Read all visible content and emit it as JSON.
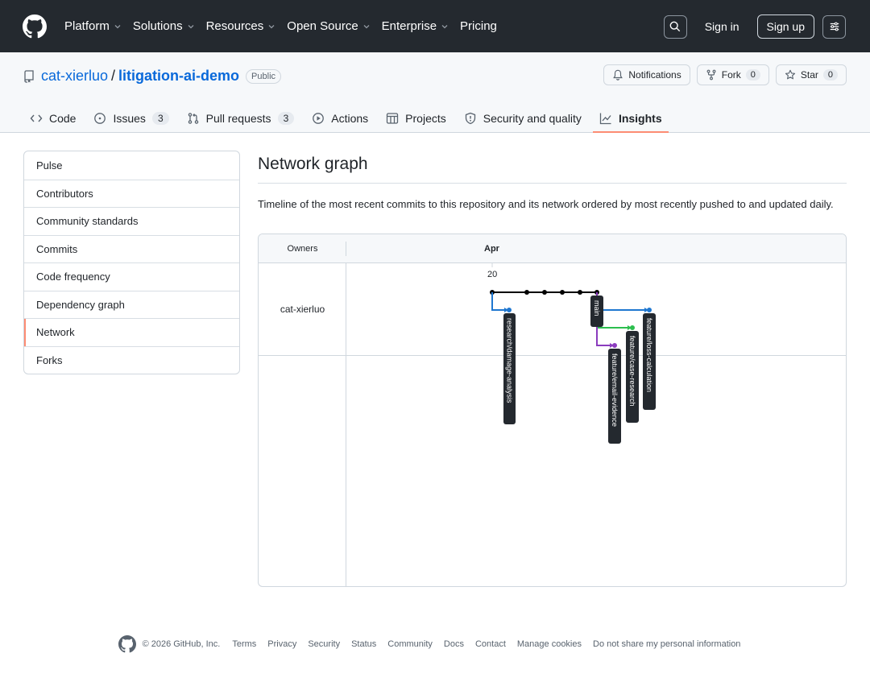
{
  "nav": {
    "items": [
      "Platform",
      "Solutions",
      "Resources",
      "Open Source",
      "Enterprise",
      "Pricing"
    ],
    "signin": "Sign in",
    "signup": "Sign up"
  },
  "repo": {
    "owner": "cat-xierluo",
    "slash": "/",
    "name": "litigation-ai-demo",
    "visibility": "Public",
    "notifications_label": "Notifications",
    "fork_label": "Fork",
    "fork_count": "0",
    "star_label": "Star",
    "star_count": "0"
  },
  "tabs": [
    {
      "label": "Code",
      "icon": "code-icon"
    },
    {
      "label": "Issues",
      "count": "3",
      "icon": "issue-icon"
    },
    {
      "label": "Pull requests",
      "count": "3",
      "icon": "pull-request-icon"
    },
    {
      "label": "Actions",
      "icon": "play-icon"
    },
    {
      "label": "Projects",
      "icon": "table-icon"
    },
    {
      "label": "Security and quality",
      "icon": "shield-icon"
    },
    {
      "label": "Insights",
      "icon": "graph-icon",
      "active": true
    }
  ],
  "sidebar": {
    "items": [
      "Pulse",
      "Contributors",
      "Community standards",
      "Commits",
      "Code frequency",
      "Dependency graph",
      "Network",
      "Forks"
    ],
    "selected": "Network"
  },
  "main": {
    "title": "Network graph",
    "description": "Timeline of the most recent commits to this repository and its network ordered by most recently pushed to and updated daily."
  },
  "network": {
    "owners_header": "Owners",
    "month": "Apr",
    "day": "20",
    "owner": "cat-xierluo",
    "colors": {
      "main": "#000000",
      "blue": "#1f77d0",
      "green": "#2cbe4e",
      "purple": "#8b3cbe"
    },
    "branches": [
      "research/damage-analysis",
      "main",
      "feature/email-evidence",
      "feature/case-research",
      "feature/loss-calculation"
    ]
  },
  "footer": {
    "copyright": "© 2026 GitHub, Inc.",
    "links": [
      "Terms",
      "Privacy",
      "Security",
      "Status",
      "Community",
      "Docs",
      "Contact",
      "Manage cookies",
      "Do not share my personal information"
    ]
  }
}
